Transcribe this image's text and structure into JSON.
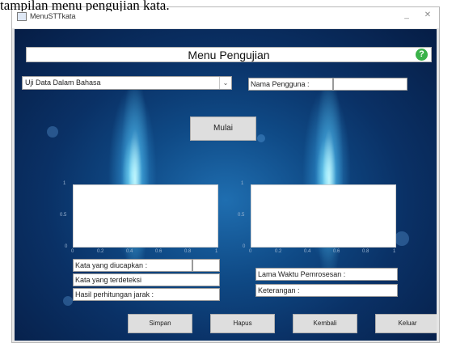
{
  "document": {
    "caption": "tampilan menu pengujian  kata."
  },
  "window": {
    "title": "MenuSTTkata",
    "minimize_glyph": "_",
    "close_glyph": "✕"
  },
  "header": {
    "title": "Menu Pengujian",
    "help_icon": "help-icon",
    "help_glyph": "?",
    "help_color": "#3bb24a"
  },
  "language_select": {
    "selected": "Uji Data Dalam Bahasa",
    "arrow": "⌄"
  },
  "username": {
    "label": "Nama Pengguna :",
    "value": ""
  },
  "mulai_button": {
    "label": "Mulai"
  },
  "plot_left": {
    "y_ticks": [
      "1",
      "0.5",
      "0"
    ],
    "x_ticks": [
      "0",
      "0.2",
      "0.4",
      "0.6",
      "0.8",
      "1"
    ]
  },
  "plot_right": {
    "y_ticks": [
      "1",
      "0.5",
      "0"
    ],
    "x_ticks": [
      "0",
      "0.2",
      "0.4",
      "0.6",
      "0.8",
      "1"
    ]
  },
  "results": {
    "kata_diucapkan_label": "Kata yang diucapkan :",
    "kata_diucapkan_value": "",
    "kata_terdeteksi_label": "Kata yang terdeteksi",
    "jarak_label": "Hasil perhitungan jarak :",
    "lama_waktu_label": "Lama Waktu Pemrosesan :",
    "keterangan_label": "Keterangan :"
  },
  "buttons": {
    "b1": "Simpan",
    "b2": "Hapus",
    "b3": "Kembali",
    "b4": "Keluar"
  },
  "colors": {
    "background_dark": "#061d45",
    "background_mid": "#1f6eb0",
    "glow": "#8cebff"
  }
}
